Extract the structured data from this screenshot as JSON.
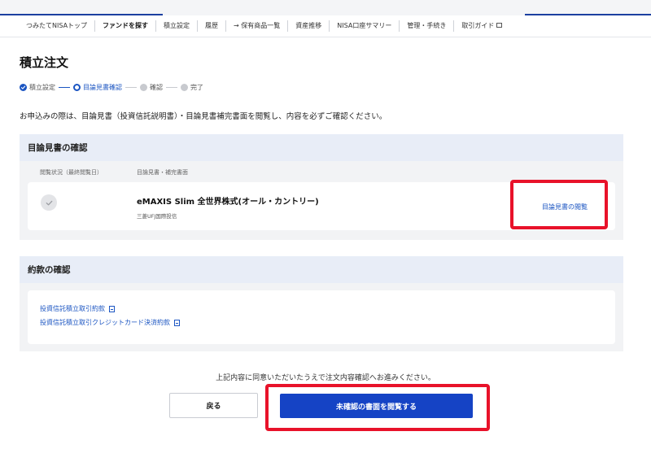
{
  "nav": {
    "items": [
      {
        "label": "つみたてNISAトップ"
      },
      {
        "label": "ファンドを探す"
      },
      {
        "label": "積立設定"
      },
      {
        "label": "履歴"
      },
      {
        "label": "→ 保有商品一覧"
      },
      {
        "label": "資産推移"
      },
      {
        "label": "NISA口座サマリー"
      },
      {
        "label": "管理・手続き"
      },
      {
        "label": "取引ガイド"
      }
    ],
    "active_index": 1
  },
  "page": {
    "title": "積立注文",
    "intro": "お申込みの際は、目論見書（投資信託説明書）・目論見書補完書面を閲覧し、内容を必ずご確認ください。"
  },
  "stepper": {
    "steps": [
      {
        "label": "積立設定",
        "state": "done"
      },
      {
        "label": "目論見書確認",
        "state": "current"
      },
      {
        "label": "確認",
        "state": "todo"
      },
      {
        "label": "完了",
        "state": "todo"
      }
    ]
  },
  "prospectus": {
    "heading": "目論見書の確認",
    "col_status": "閲覧状況（最終閲覧日）",
    "col_docs": "目論見書・補完書面",
    "fund_name": "eMAXIS Slim 全世界株式(オール・カントリー)",
    "fund_company": "三菱UFJ国際投信",
    "view_link": "目論見書の閲覧"
  },
  "terms": {
    "heading": "約款の確認",
    "links": [
      "投資信託積立取引約款",
      "投資信託積立取引クレジットカード決済約款"
    ]
  },
  "footer": {
    "agree_text": "上記内容に同意いただいたうえで注文内容確認へお進みください。",
    "back_label": "戻る",
    "primary_label": "未確認の書面を閲覧する"
  },
  "colors": {
    "accent": "#1543c5",
    "link": "#1b55c2",
    "highlight": "#e8122a",
    "panel_head": "#e8edf7"
  }
}
